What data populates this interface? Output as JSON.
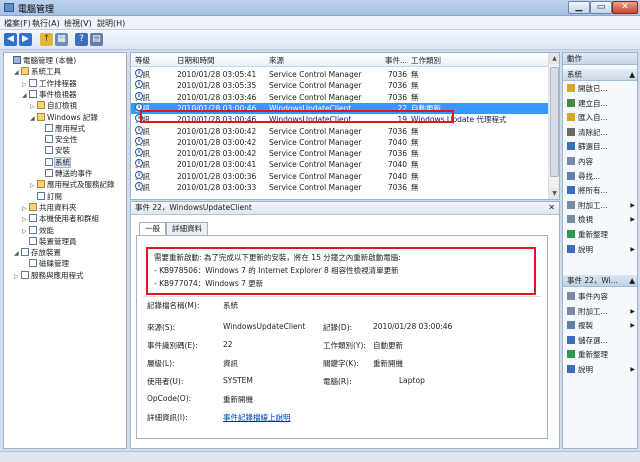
{
  "window": {
    "title": "電腦管理"
  },
  "menu": [
    "檔案(F)",
    "執行(A)",
    "檢視(V)",
    "說明(H)"
  ],
  "tree": [
    {
      "label": "電腦管理 (本機)",
      "exp": "",
      "icon": "pc"
    },
    {
      "label": "系統工具",
      "exp": "◢",
      "icon": "folder"
    },
    {
      "label": "工作排程器",
      "exp": "▷",
      "icon": "log"
    },
    {
      "label": "事件檢視器",
      "exp": "◢",
      "icon": "log"
    },
    {
      "label": "自訂檢視",
      "exp": "▷",
      "icon": "folder"
    },
    {
      "label": "Windows 記錄",
      "exp": "◢",
      "icon": "folder"
    },
    {
      "label": "應用程式",
      "exp": "",
      "icon": "log"
    },
    {
      "label": "安全性",
      "exp": "",
      "icon": "log"
    },
    {
      "label": "安裝",
      "exp": "",
      "icon": "log"
    },
    {
      "label": "系統",
      "exp": "",
      "icon": "log",
      "selected": true
    },
    {
      "label": "轉送的事件",
      "exp": "",
      "icon": "log"
    },
    {
      "label": "應用程式及服務記錄",
      "exp": "▷",
      "icon": "folder"
    },
    {
      "label": "訂閱",
      "exp": "",
      "icon": "log"
    },
    {
      "label": "共用資料夾",
      "exp": "▷",
      "icon": "folder"
    },
    {
      "label": "本機使用者和群組",
      "exp": "▷",
      "icon": "log"
    },
    {
      "label": "效能",
      "exp": "▷",
      "icon": "log"
    },
    {
      "label": "裝置管理員",
      "exp": "",
      "icon": "log"
    },
    {
      "label": "存放裝置",
      "exp": "◢",
      "icon": "log"
    },
    {
      "label": "磁碟管理",
      "exp": "",
      "icon": "log"
    },
    {
      "label": "服務與應用程式",
      "exp": "▷",
      "icon": "log"
    }
  ],
  "events": {
    "columns": [
      "等級",
      "日期和時間",
      "來源",
      "事件...",
      "工作類別"
    ],
    "rows": [
      {
        "level": "資訊",
        "datetime": "2010/01/28 03:05:41",
        "source": "Service Control Manager",
        "id": "7036",
        "category": "無"
      },
      {
        "level": "資訊",
        "datetime": "2010/01/28 03:05:35",
        "source": "Service Control Manager",
        "id": "7036",
        "category": "無"
      },
      {
        "level": "資訊",
        "datetime": "2010/01/28 03:03:46",
        "source": "Service Control Manager",
        "id": "7036",
        "category": "無"
      },
      {
        "level": "資訊",
        "datetime": "2010/01/28 03:00:46",
        "source": "WindowsUpdateClient",
        "id": "22",
        "category": "自動更新",
        "selected": true
      },
      {
        "level": "資訊",
        "datetime": "2010/01/28 03:00:46",
        "source": "WindowsUpdateClient",
        "id": "19",
        "category": "Windows Update 代理程式"
      },
      {
        "level": "資訊",
        "datetime": "2010/01/28 03:00:42",
        "source": "Service Control Manager",
        "id": "7036",
        "category": "無"
      },
      {
        "level": "資訊",
        "datetime": "2010/01/28 03:00:42",
        "source": "Service Control Manager",
        "id": "7040",
        "category": "無"
      },
      {
        "level": "資訊",
        "datetime": "2010/01/28 03:00:42",
        "source": "Service Control Manager",
        "id": "7036",
        "category": "無"
      },
      {
        "level": "資訊",
        "datetime": "2010/01/28 03:00:41",
        "source": "Service Control Manager",
        "id": "7040",
        "category": "無"
      },
      {
        "level": "資訊",
        "datetime": "2010/01/28 03:00:36",
        "source": "Service Control Manager",
        "id": "7040",
        "category": "無"
      },
      {
        "level": "資訊",
        "datetime": "2010/01/28 03:00:33",
        "source": "Service Control Manager",
        "id": "7036",
        "category": "無"
      }
    ]
  },
  "detail": {
    "title": "事件 22，WindowsUpdateClient",
    "tabs": [
      "一般",
      "詳細資料"
    ],
    "message": [
      "需要重新啟動: 為了完成以下更新的安裝，將在 15 分鐘之內重新啟動電腦:",
      "- KB978506：Windows 7 的 Internet Explorer 8 相容性檢視清單更新",
      "- KB977074：Windows 7 更新"
    ],
    "log_name_label": "記錄檔名稱(M):",
    "log_name": "系統",
    "source_label": "來源(S):",
    "source": "WindowsUpdateClient",
    "logged_label": "記錄(D):",
    "logged": "2010/01/28 03:00:46",
    "event_id_label": "事件識別碼(E):",
    "event_id": "22",
    "task_label": "工作類別(Y):",
    "task": "自動更新",
    "level_label": "層級(L):",
    "level": "資訊",
    "keywords_label": "關鍵字(K):",
    "keywords": "重新開機",
    "user_label": "使用者(U):",
    "user": "SYSTEM",
    "computer_label": "電腦(R):",
    "computer": "Laptop",
    "opcode_label": "OpCode(O):",
    "opcode": "重新開機",
    "more_info_label": "詳細資訊(I):",
    "more_info_link": "事件記錄檔線上說明"
  },
  "actions": {
    "header": "動作",
    "section1": "系統",
    "items1": [
      "開啟已...",
      "建立自...",
      "匯入自...",
      "清除記...",
      "篩選目...",
      "內容",
      "尋找...",
      "將所有...",
      "附加工...",
      "檢視",
      "重新整理",
      "說明"
    ],
    "section2": "事件 22，Wi...",
    "items2": [
      "事件內容",
      "附加工...",
      "複製",
      "儲存選...",
      "重新整理",
      "說明"
    ]
  }
}
